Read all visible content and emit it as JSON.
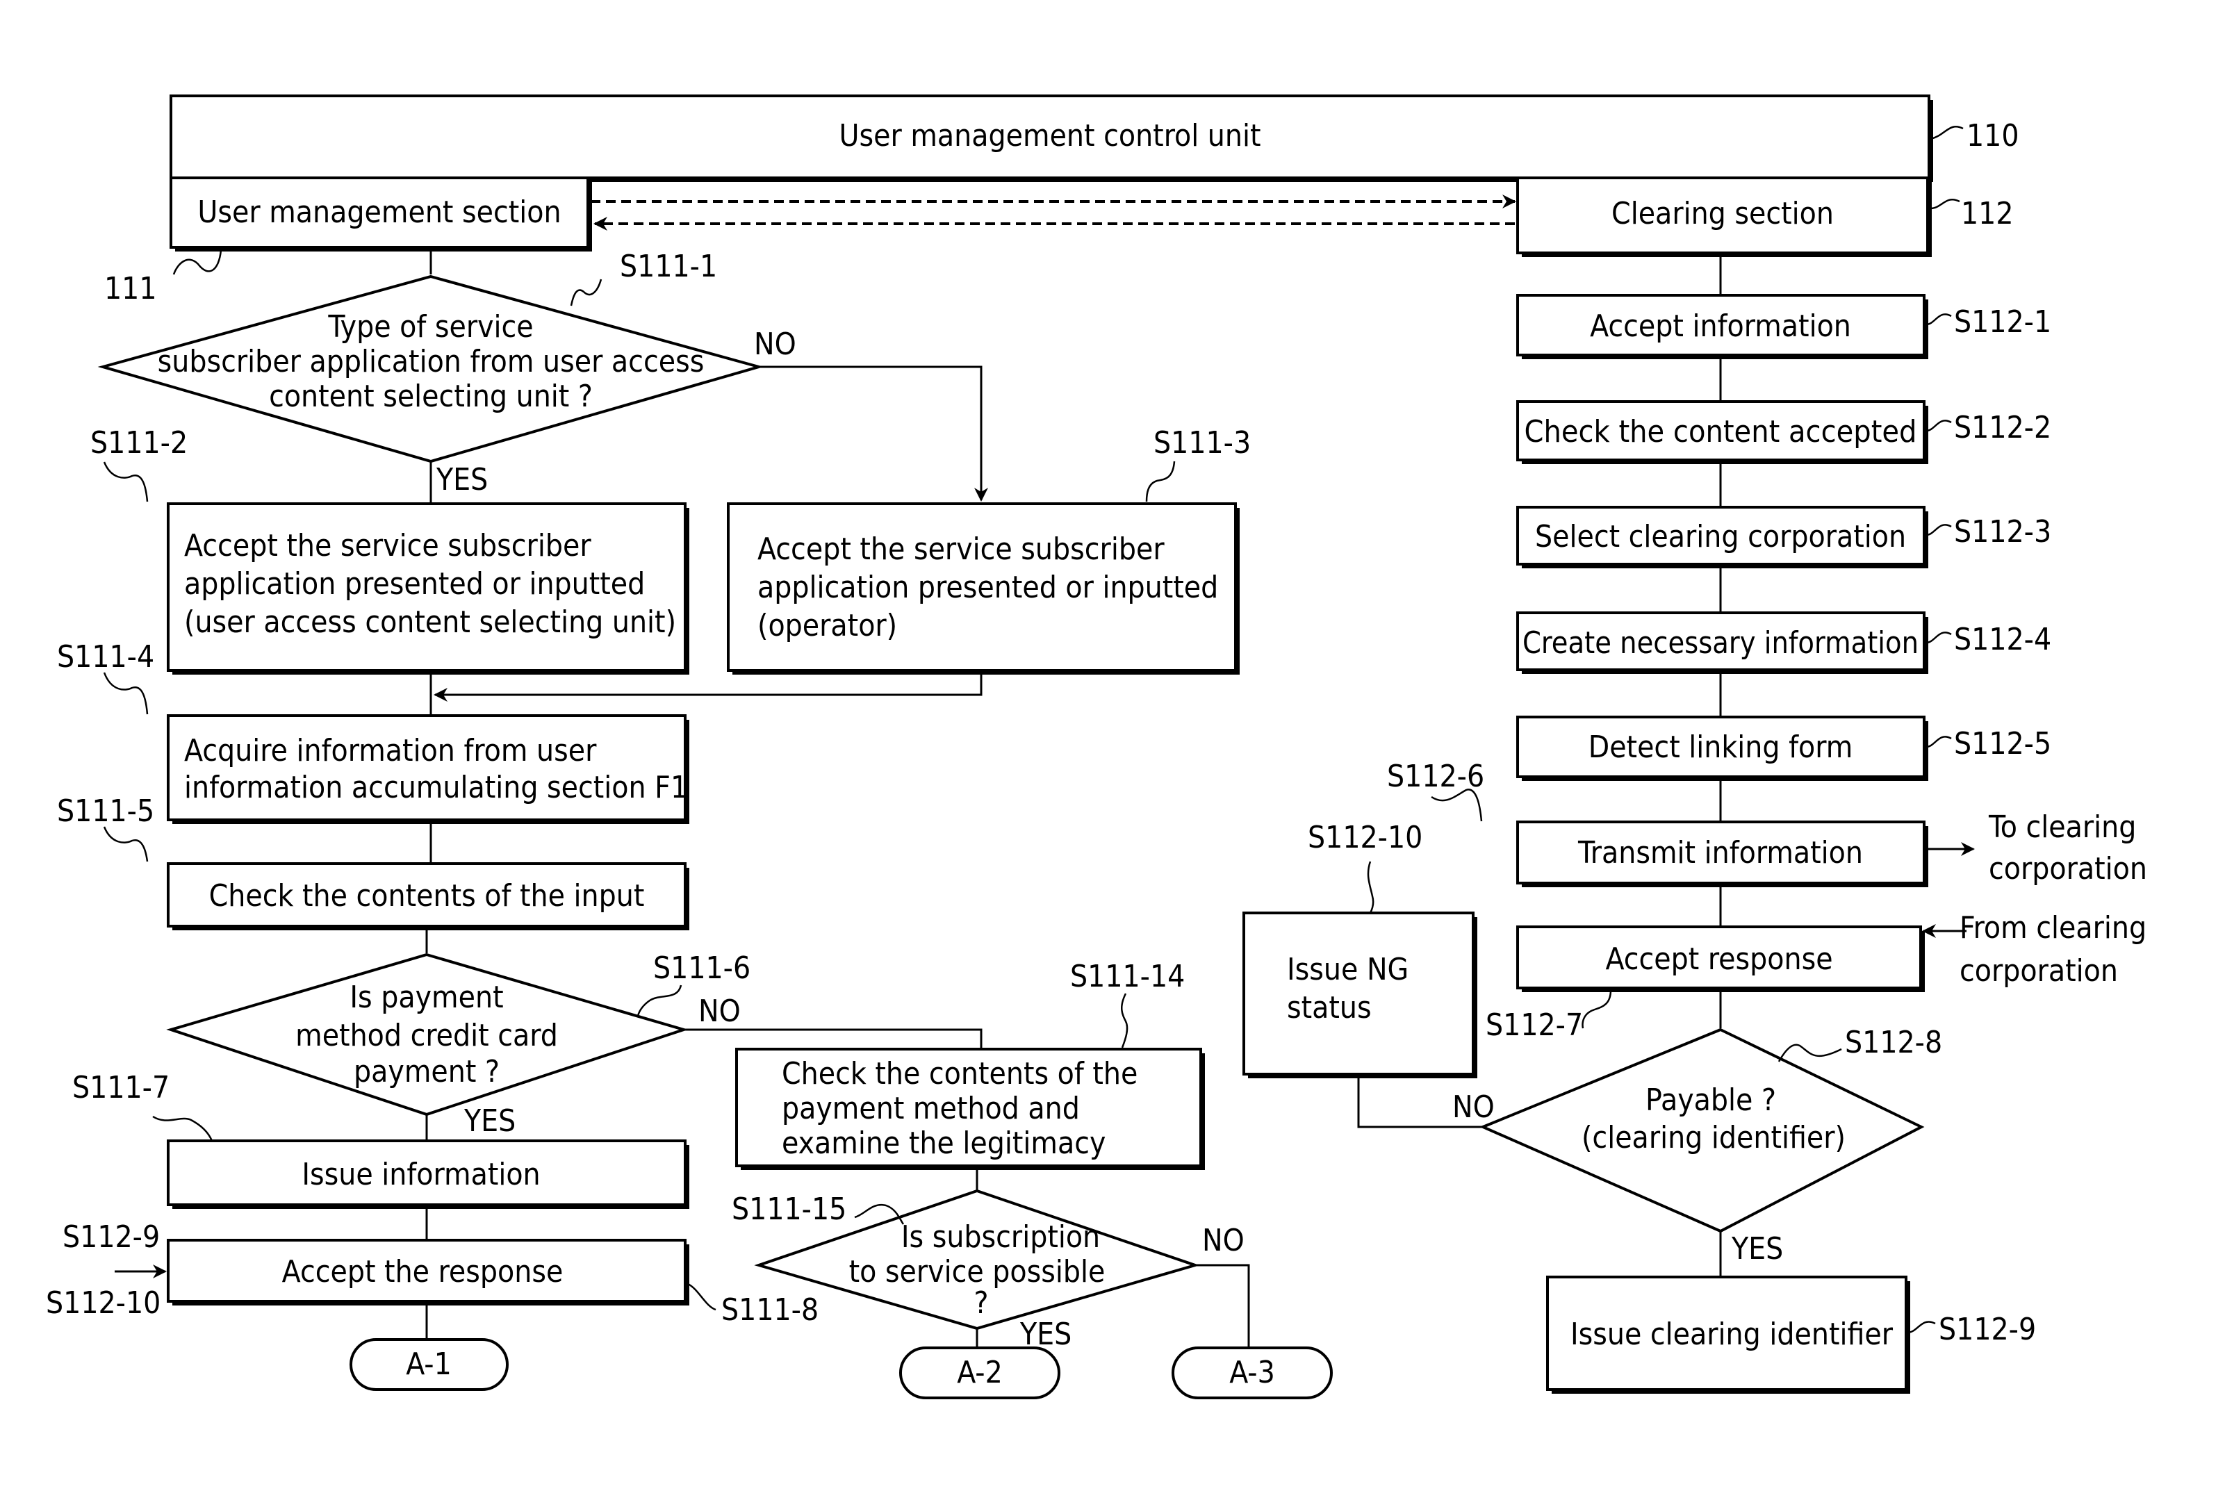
{
  "header": {
    "control_unit": "User management control unit",
    "control_unit_ref": "110",
    "user_section": "User management section",
    "user_section_ref": "111",
    "clearing_section": "Clearing section",
    "clearing_section_ref": "112"
  },
  "left": {
    "d1": {
      "lines": [
        "Type of service",
        "subscriber application from user access",
        "content selecting unit ?"
      ],
      "ref": "S111-1",
      "yes": "YES",
      "no": "NO"
    },
    "b2": {
      "lines": [
        "Accept the service subscriber",
        "application presented or inputted",
        "(user access content selecting unit)"
      ],
      "ref": "S111-2"
    },
    "b3": {
      "lines": [
        "Accept the service subscriber",
        "application presented or inputted",
        "(operator)"
      ],
      "ref": "S111-3"
    },
    "b4": {
      "lines": [
        "Acquire information from user",
        "information accumulating section F1"
      ],
      "ref": "S111-4"
    },
    "b5": {
      "lines": [
        "Check the contents of the input"
      ],
      "ref": "S111-5"
    },
    "d6": {
      "lines": [
        "Is payment",
        "method credit card",
        "payment ?"
      ],
      "ref": "S111-6",
      "yes": "YES",
      "no": "NO"
    },
    "b7": {
      "lines": [
        "Issue information"
      ],
      "ref": "S111-7"
    },
    "b8": {
      "lines": [
        "Accept the response"
      ],
      "ref": "S111-8",
      "in_top": "S112-9",
      "in_bottom": "S112-10"
    },
    "b14": {
      "lines": [
        "Check the contents of the",
        "payment method and",
        "examine the legitimacy"
      ],
      "ref": "S111-14"
    },
    "d15": {
      "lines": [
        "Is subscription",
        "to service possible",
        "?"
      ],
      "ref": "S111-15",
      "yes": "YES",
      "no": "NO"
    },
    "terminals": [
      "A-1",
      "A-2",
      "A-3"
    ]
  },
  "right": {
    "s1": {
      "label": "Accept information",
      "ref": "S112-1"
    },
    "s2": {
      "label": "Check the content accepted",
      "ref": "S112-2"
    },
    "s3": {
      "label": "Select clearing corporation",
      "ref": "S112-3"
    },
    "s4": {
      "label": "Create necessary information",
      "ref": "S112-4"
    },
    "s5": {
      "label": "Detect linking form",
      "ref": "S112-5"
    },
    "s6": {
      "label": "Transmit information",
      "ref": "S112-6",
      "out": [
        "To clearing",
        "corporation"
      ]
    },
    "s7": {
      "label": "Accept response",
      "ref": "S112-7",
      "in": [
        "From clearing",
        "corporation"
      ]
    },
    "d8": {
      "lines": [
        "Payable ?",
        "(clearing identifier)"
      ],
      "ref": "S112-8",
      "yes": "YES",
      "no": "NO"
    },
    "s9": {
      "label": "Issue clearing identifier",
      "ref": "S112-9"
    },
    "s10": {
      "lines": [
        "Issue NG",
        "status"
      ],
      "ref": "S112-10"
    }
  }
}
